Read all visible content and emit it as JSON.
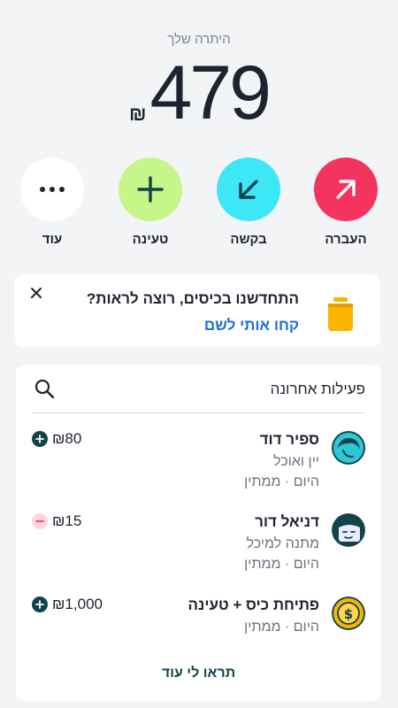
{
  "balance": {
    "label": "היתרה שלך",
    "currency": "₪",
    "amount": "479"
  },
  "actions": [
    {
      "label": "העברה",
      "icon": "arrow-up-right-icon"
    },
    {
      "label": "בקשה",
      "icon": "arrow-down-left-icon"
    },
    {
      "label": "טעינה",
      "icon": "plus-icon"
    },
    {
      "label": "עוד",
      "icon": "more-dots-icon"
    }
  ],
  "promo": {
    "title": "התחדשנו בכיסים, רוצה לראות?",
    "link": "קחו אותי לשם",
    "icon": "jar-icon"
  },
  "activity": {
    "title": "פעילות אחרונה",
    "see_more": "תראו לי עוד",
    "items": [
      {
        "name": "ספיר דוד",
        "note": "יין ואוכל",
        "meta": "היום · ממתין",
        "amount": "₪80",
        "direction": "plus"
      },
      {
        "name": "דניאל דור",
        "note": "מתנה למיכל",
        "meta": "היום · ממתין",
        "amount": "₪15",
        "direction": "minus"
      },
      {
        "name": "פתיחת כיס + טעינה",
        "note": "",
        "meta": "היום · ממתין",
        "amount": "₪1,000",
        "direction": "plus"
      }
    ]
  },
  "colors": {
    "transfer": "#f5335f",
    "request": "#3ee7f5",
    "topup": "#c6f58a",
    "link": "#1d6fd9",
    "dark_teal": "#12434d"
  }
}
